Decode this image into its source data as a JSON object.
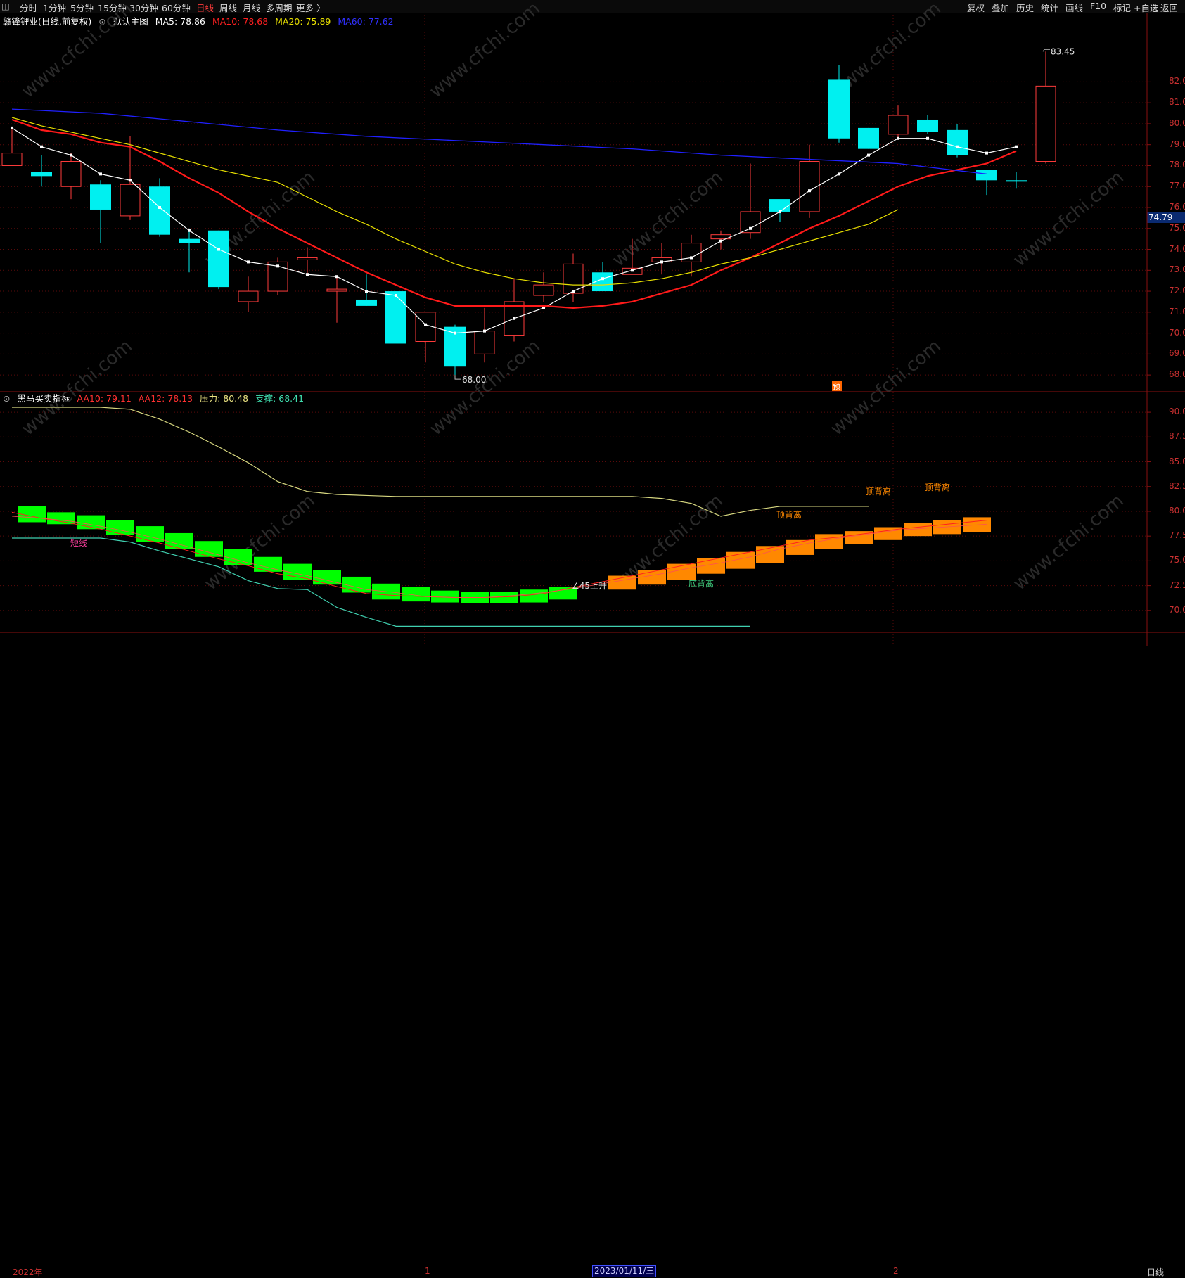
{
  "toolbar": {
    "left": [
      "分时",
      "1分钟",
      "5分钟",
      "15分钟",
      "30分钟",
      "60分钟",
      "日线",
      "周线",
      "月线",
      "多周期",
      "更多 〉"
    ],
    "active": "日线",
    "right": [
      "复权",
      "叠加",
      "历史",
      "统计",
      "画线",
      "F10",
      "标记",
      "+自选",
      "返回"
    ]
  },
  "main_header": {
    "title": "赣锋锂业(日线,前复权)",
    "template": "默认主图",
    "ma5": "MA5: 78.86",
    "ma10": "MA10: 78.68",
    "ma20": "MA20: 75.89",
    "ma60": "MA60: 77.62"
  },
  "sub_header": {
    "title": "黑马买卖指标",
    "aa10": "AA10: 79.11",
    "aa12": "AA12: 78.13",
    "pressure": "压力: 80.48",
    "support": "支撑: 68.41"
  },
  "colors": {
    "up": "#ff3b3b",
    "down": "#00f0f0",
    "ma5": "#ffffff",
    "ma10": "#ff1a1a",
    "ma20": "#e8e000",
    "ma60": "#2020ff",
    "green": "#00ff00",
    "orange": "#ff8800"
  },
  "labels": {
    "high": "83.45",
    "low": "68.00",
    "current": "74.79",
    "marker": "预",
    "short": "短线",
    "rise": "∠45上升",
    "div1": "顶背离",
    "div2": "顶背离",
    "div3": "顶背离",
    "bottom": "底背离",
    "watermark": "www.cfchi.com"
  },
  "bottom": {
    "year": "2022年",
    "m1": "1",
    "date": "2023/01/11/三",
    "m2": "2",
    "period": "日线"
  },
  "chart_data": [
    {
      "type": "candlestick",
      "title": "赣锋锂业(日线,前复权)",
      "ylim": [
        67.5,
        84.5
      ],
      "y_ticks": [
        68,
        69,
        70,
        71,
        72,
        73,
        74,
        75,
        76,
        77,
        78,
        79,
        80,
        81,
        82
      ],
      "candles": [
        {
          "o": 78.0,
          "h": 79.8,
          "l": 78.0,
          "c": 78.6,
          "u": true
        },
        {
          "o": 77.7,
          "h": 78.5,
          "l": 77.0,
          "c": 77.5,
          "u": false
        },
        {
          "o": 78.2,
          "h": 78.6,
          "l": 76.4,
          "c": 77.0,
          "u": true
        },
        {
          "o": 77.1,
          "h": 77.3,
          "l": 74.3,
          "c": 75.9,
          "u": false
        },
        {
          "o": 77.1,
          "h": 79.4,
          "l": 75.4,
          "c": 75.6,
          "u": true
        },
        {
          "o": 77.0,
          "h": 77.4,
          "l": 74.6,
          "c": 74.7,
          "u": false
        },
        {
          "o": 74.5,
          "h": 75.0,
          "l": 72.9,
          "c": 74.3,
          "u": false
        },
        {
          "o": 74.9,
          "h": 74.9,
          "l": 72.1,
          "c": 72.2,
          "u": false
        },
        {
          "o": 72.0,
          "h": 72.7,
          "l": 71.0,
          "c": 71.5,
          "u": true
        },
        {
          "o": 73.4,
          "h": 73.6,
          "l": 71.8,
          "c": 72.0,
          "u": true
        },
        {
          "o": 73.6,
          "h": 74.1,
          "l": 72.8,
          "c": 73.5,
          "u": true
        },
        {
          "o": 72.1,
          "h": 72.7,
          "l": 70.5,
          "c": 72.0,
          "u": true
        },
        {
          "o": 71.6,
          "h": 72.8,
          "l": 71.3,
          "c": 71.3,
          "u": false
        },
        {
          "o": 72.0,
          "h": 72.0,
          "l": 69.6,
          "c": 69.5,
          "u": false
        },
        {
          "o": 71.0,
          "h": 71.0,
          "l": 68.6,
          "c": 69.6,
          "u": true
        },
        {
          "o": 70.3,
          "h": 70.4,
          "l": 68.0,
          "c": 68.4,
          "u": false
        },
        {
          "o": 69.0,
          "h": 71.2,
          "l": 68.6,
          "c": 70.1,
          "u": true
        },
        {
          "o": 69.9,
          "h": 72.6,
          "l": 69.6,
          "c": 71.5,
          "u": true
        },
        {
          "o": 71.8,
          "h": 72.9,
          "l": 71.5,
          "c": 72.3,
          "u": true
        },
        {
          "o": 71.9,
          "h": 73.8,
          "l": 71.5,
          "c": 73.3,
          "u": true
        },
        {
          "o": 72.9,
          "h": 73.4,
          "l": 72.0,
          "c": 72.0,
          "u": false
        },
        {
          "o": 72.8,
          "h": 74.5,
          "l": 72.8,
          "c": 73.1,
          "u": true
        },
        {
          "o": 73.4,
          "h": 74.3,
          "l": 72.8,
          "c": 73.6,
          "u": true
        },
        {
          "o": 73.4,
          "h": 74.7,
          "l": 72.7,
          "c": 74.3,
          "u": true
        },
        {
          "o": 74.5,
          "h": 74.9,
          "l": 74.0,
          "c": 74.7,
          "u": true
        },
        {
          "o": 74.8,
          "h": 78.1,
          "l": 74.5,
          "c": 75.8,
          "u": true
        },
        {
          "o": 76.4,
          "h": 76.3,
          "l": 75.3,
          "c": 75.8,
          "u": false
        },
        {
          "o": 75.8,
          "h": 79.0,
          "l": 75.5,
          "c": 78.2,
          "u": true
        },
        {
          "o": 82.1,
          "h": 82.8,
          "l": 79.1,
          "c": 79.3,
          "u": false
        },
        {
          "o": 79.8,
          "h": 79.8,
          "l": 78.8,
          "c": 78.8,
          "u": false
        },
        {
          "o": 79.5,
          "h": 80.9,
          "l": 79.3,
          "c": 80.4,
          "u": true
        },
        {
          "o": 80.2,
          "h": 80.4,
          "l": 79.5,
          "c": 79.6,
          "u": false
        },
        {
          "o": 79.7,
          "h": 80.0,
          "l": 78.4,
          "c": 78.5,
          "u": false
        },
        {
          "o": 77.8,
          "h": 77.8,
          "l": 76.6,
          "c": 77.3,
          "u": false
        },
        {
          "o": 77.3,
          "h": 77.7,
          "l": 76.9,
          "c": 77.3,
          "u": false
        },
        {
          "o": 78.2,
          "h": 83.45,
          "l": 78.1,
          "c": 81.8,
          "u": true
        }
      ],
      "series": [
        {
          "name": "MA5",
          "values": [
            79.8,
            78.9,
            78.5,
            77.6,
            77.3,
            76.0,
            74.9,
            74.0,
            73.4,
            73.2,
            72.8,
            72.7,
            72.0,
            71.8,
            70.4,
            70.0,
            70.1,
            70.7,
            71.2,
            72.0,
            72.6,
            73.0,
            73.4,
            73.6,
            74.4,
            75.0,
            75.8,
            76.8,
            77.6,
            78.5,
            79.3,
            79.3,
            78.9,
            78.6,
            78.9
          ]
        },
        {
          "name": "MA10",
          "values": [
            80.2,
            79.7,
            79.5,
            79.1,
            78.9,
            78.2,
            77.4,
            76.7,
            75.8,
            75.0,
            74.3,
            73.6,
            72.9,
            72.3,
            71.7,
            71.3,
            71.3,
            71.3,
            71.3,
            71.2,
            71.3,
            71.5,
            71.9,
            72.3,
            73.0,
            73.6,
            74.3,
            75.0,
            75.6,
            76.3,
            77.0,
            77.5,
            77.8,
            78.1,
            78.7
          ]
        },
        {
          "name": "MA20",
          "values": [
            80.3,
            79.9,
            79.6,
            79.3,
            79.0,
            78.6,
            78.2,
            77.8,
            77.5,
            77.2,
            76.5,
            75.8,
            75.2,
            74.5,
            73.9,
            73.3,
            72.9,
            72.6,
            72.4,
            72.3,
            72.3,
            72.4,
            72.6,
            72.9,
            73.3,
            73.6,
            74.0,
            74.4,
            74.8,
            75.2,
            75.9
          ]
        },
        {
          "name": "MA60",
          "values": [
            80.7,
            80.5,
            80.1,
            79.7,
            79.4,
            79.2,
            79.0,
            78.8,
            78.5,
            78.3,
            78.1,
            77.6
          ]
        }
      ]
    },
    {
      "type": "line",
      "title": "黑马买卖指标",
      "ylim": [
        68.0,
        91.0
      ],
      "y_ticks": [
        70,
        72.5,
        75,
        77.5,
        80,
        82.5,
        85,
        87.5,
        90
      ],
      "series": [
        {
          "name": "压力",
          "values": [
            90.5,
            90.5,
            90.5,
            90.5,
            90.3,
            89.3,
            88.0,
            86.5,
            84.9,
            83.0,
            82.0,
            81.7,
            81.6,
            81.5,
            81.5,
            81.5,
            81.5,
            81.5,
            81.5,
            81.5,
            81.5,
            81.5,
            81.3,
            80.8,
            79.5,
            80.1,
            80.5,
            80.5,
            80.5,
            80.5
          ]
        },
        {
          "name": "支撑",
          "values": [
            77.3,
            77.3,
            77.3,
            77.3,
            76.9,
            76.0,
            75.2,
            74.4,
            73.0,
            72.2,
            72.1,
            70.3,
            69.3,
            68.4,
            68.4,
            68.4,
            68.4,
            68.4,
            68.4,
            68.4,
            68.4,
            68.4,
            68.4,
            68.4,
            68.4,
            68.4
          ]
        },
        {
          "name": "AA10",
          "values": [
            79.9,
            79.3,
            78.8,
            78.2,
            77.5,
            76.8,
            76.0,
            75.2,
            74.5,
            73.7,
            73.2,
            72.4,
            71.7,
            71.5,
            71.4,
            71.3,
            71.3,
            71.4,
            71.7,
            72.3,
            72.9,
            73.5,
            74.1,
            74.7,
            75.3,
            75.9,
            76.5,
            77.1,
            77.4,
            77.8,
            78.2,
            78.5,
            78.8,
            79.1
          ]
        },
        {
          "name": "AA12",
          "values": [
            79.5,
            79.3,
            79.0,
            78.5,
            77.9,
            77.2,
            76.4,
            75.6,
            74.8,
            74.1,
            73.5,
            72.8,
            72.1,
            71.8,
            71.4,
            71.3,
            71.3,
            71.5,
            71.8,
            72.2,
            72.7,
            73.2,
            73.7,
            74.3,
            74.8,
            75.4,
            76.2,
            76.8,
            77.3,
            77.7,
            78.1,
            78.3,
            78.5,
            78.7
          ]
        }
      ]
    }
  ]
}
